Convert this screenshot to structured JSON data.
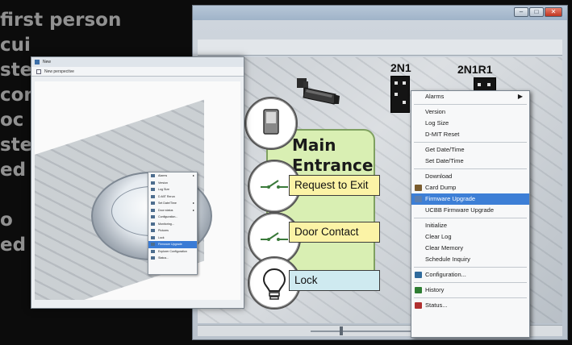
{
  "background_text": {
    "lines": [
      "first person",
      "cui",
      "ste",
      "con",
      "oc",
      "ste",
      "ed",
      "",
      "o",
      "ed"
    ]
  },
  "main_window": {
    "controls": [
      "–",
      "□",
      "✕"
    ]
  },
  "small_window": {
    "title": "New",
    "tab_label": "New perspective"
  },
  "small_context_menu": {
    "items": [
      {
        "label": "Alarms",
        "submenu": true
      },
      {
        "label": "Version"
      },
      {
        "label": "Log Size"
      },
      {
        "label": "D-MIT Rerun"
      },
      {
        "label": "Set Date/Time",
        "submenu": true
      },
      {
        "label": "Door status",
        "submenu": true
      },
      {
        "label": "Configuration..."
      },
      {
        "label": "Monitoring..."
      },
      {
        "label": "Pictures"
      },
      {
        "label": "Lock"
      },
      {
        "label": "Firmware Upgrade",
        "highlighted": true
      },
      {
        "label": "Explorer Configuration"
      },
      {
        "label": "Status..."
      }
    ]
  },
  "devices": {
    "device1": "2N1",
    "device2": "2N1R1"
  },
  "door": {
    "title_line1": "Main",
    "title_line2": "Entrance",
    "request_to_exit": "Request to Exit",
    "door_contact": "Door Contact",
    "lock": "Lock"
  },
  "main_context_menu": {
    "items": [
      {
        "label": "Alarms",
        "submenu": true,
        "icon": "none"
      },
      {
        "sep": true
      },
      {
        "label": "Version",
        "icon": "none"
      },
      {
        "label": "Log Size",
        "icon": "none"
      },
      {
        "label": "D-MIT Reset",
        "icon": "none"
      },
      {
        "sep": true
      },
      {
        "label": "Get Date/Time",
        "icon": "none"
      },
      {
        "label": "Set Date/Time",
        "icon": "none"
      },
      {
        "sep": true
      },
      {
        "label": "Download",
        "icon": "none"
      },
      {
        "label": "Card Dump",
        "icon": "card-dump-icon"
      },
      {
        "label": "Firmware Upgrade",
        "icon": "firmware-icon",
        "highlighted": true
      },
      {
        "label": "UCBB Firmware Upgrade",
        "icon": "none"
      },
      {
        "sep": true
      },
      {
        "label": "Initialize",
        "icon": "none"
      },
      {
        "label": "Clear Log",
        "icon": "none"
      },
      {
        "label": "Clear Memory",
        "icon": "none"
      },
      {
        "label": "Schedule Inquiry",
        "icon": "none"
      },
      {
        "sep": true
      },
      {
        "label": "Configuration...",
        "icon": "configuration-icon"
      },
      {
        "sep": true
      },
      {
        "label": "History",
        "icon": "history-icon"
      },
      {
        "sep": true
      },
      {
        "label": "Status...",
        "icon": "status-icon"
      }
    ]
  },
  "colors": {
    "menu_highlight": "#3d7fd6",
    "door_panel": "#d9efb3",
    "tag_yellow": "#fbf3a6",
    "tag_blue": "#cfeaf0"
  }
}
